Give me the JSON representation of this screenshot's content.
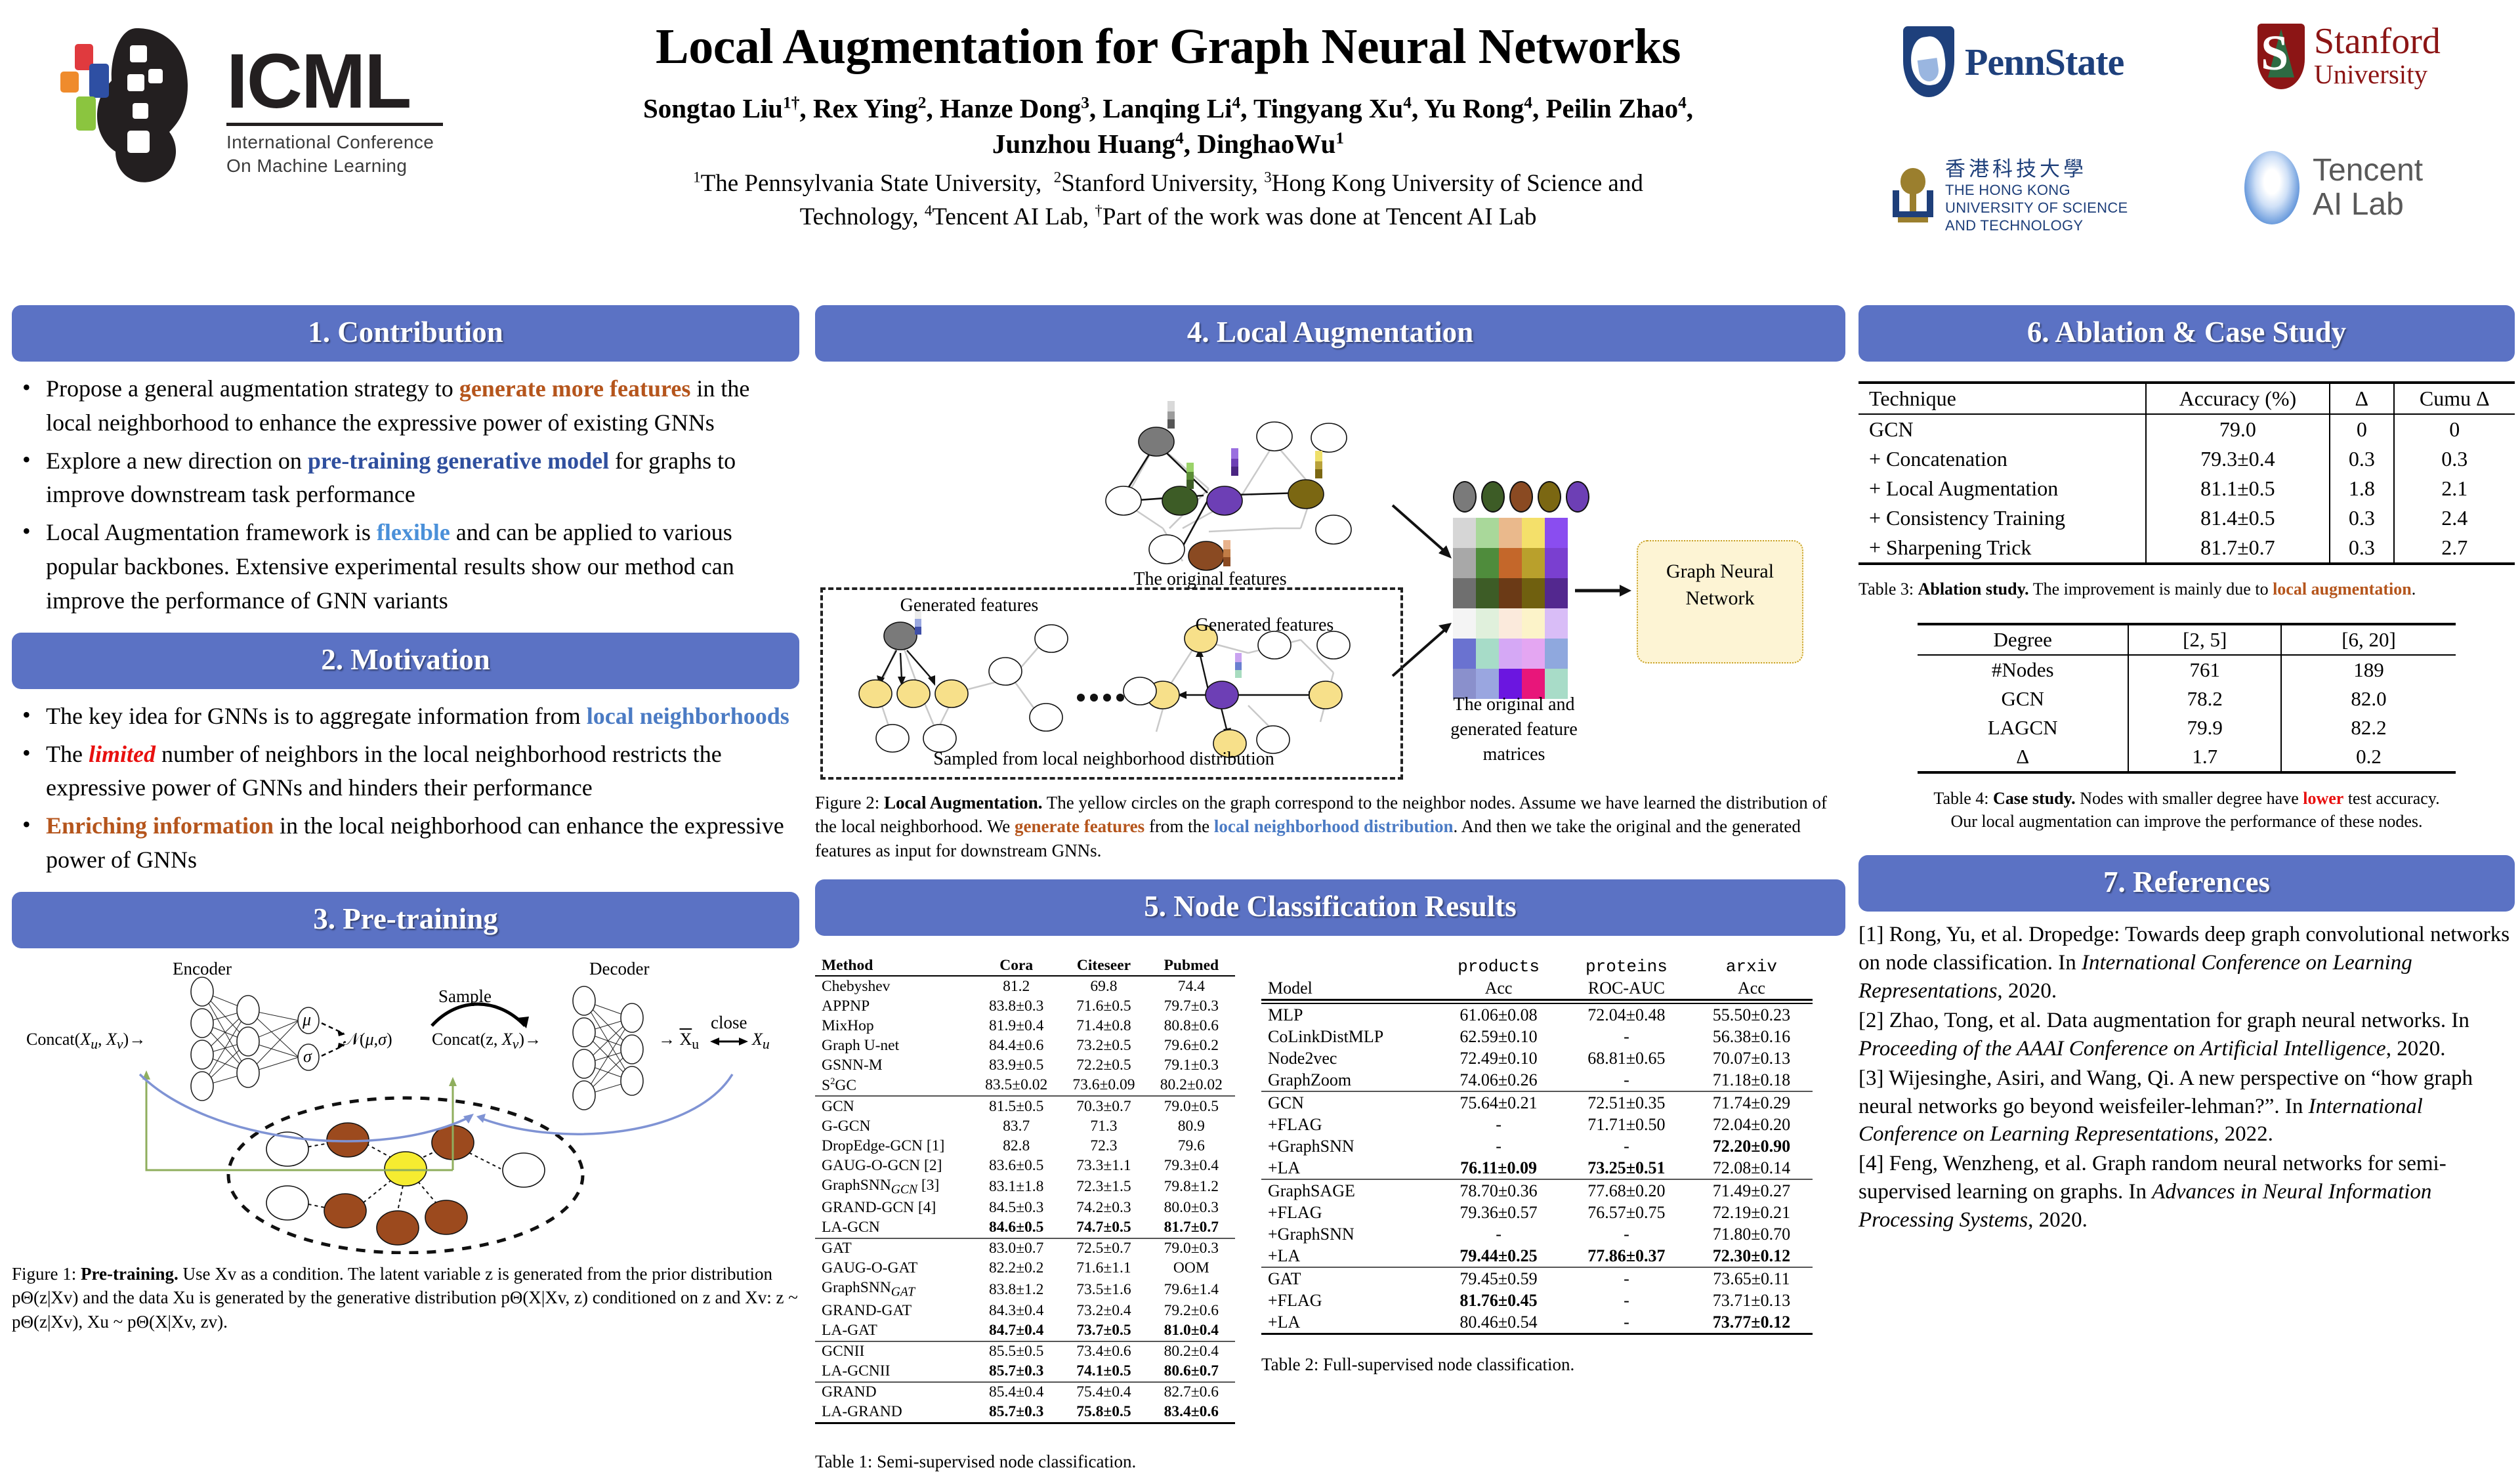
{
  "header": {
    "conference_logo": {
      "letters": "ICML",
      "line1": "International Conference",
      "line2": "On Machine Learning"
    },
    "title": "Local Augmentation for Graph Neural Networks",
    "authors_line1": "Songtao Liu1†, Rex Ying2, Hanze Dong3, Lanqing Li4, Tingyang Xu4, Yu Rong4, Peilin Zhao4,",
    "authors_line2": "Junzhou Huang4, DinghaoWu1",
    "affil_line1": "1The Pennsylvania State University,  2Stanford University, 3Hong Kong University of Science and",
    "affil_line2": "Technology, 4Tencent AI Lab, †Part of the work was done at Tencent AI Lab",
    "logos": {
      "pennstate": "PennState",
      "stanford_l1": "Stanford",
      "stanford_l2": "University",
      "stanford_mark_letter": "S",
      "hkust_cn": "香港科技大學",
      "hkust_en1": "THE HONG KONG",
      "hkust_en2": "UNIVERSITY OF SCIENCE",
      "hkust_en3": "AND TECHNOLOGY",
      "tencent_l1": "Tencent",
      "tencent_l2": "AI Lab"
    }
  },
  "section1": {
    "heading": "1. Contribution",
    "bullets": [
      {
        "parts": [
          {
            "t": "Propose a general augmentation strategy to ",
            "s": ""
          },
          {
            "t": "generate more features",
            "s": "orange"
          },
          {
            "t": " in the local neighborhood to enhance the expressive power of existing GNNs",
            "s": ""
          }
        ]
      },
      {
        "parts": [
          {
            "t": "Explore a new direction on ",
            "s": ""
          },
          {
            "t": "pre-training generative model",
            "s": "navy"
          },
          {
            "t": " for graphs to improve downstream task performance",
            "s": ""
          }
        ]
      },
      {
        "parts": [
          {
            "t": "Local Augmentation framework is ",
            "s": ""
          },
          {
            "t": "flexible",
            "s": "blue"
          },
          {
            "t": " and can be applied to various popular backbones. Extensive experimental results show our method can improve the performance of GNN variants",
            "s": ""
          }
        ]
      }
    ]
  },
  "section2": {
    "heading": "2. Motivation",
    "bullets": [
      {
        "parts": [
          {
            "t": "The key idea for GNNs is to aggregate information from ",
            "s": ""
          },
          {
            "t": "local neighborhoods",
            "s": "midblue"
          }
        ]
      },
      {
        "parts": [
          {
            "t": "The ",
            "s": ""
          },
          {
            "t": "limited",
            "s": "red-i"
          },
          {
            "t": " number of neighbors in the local neighborhood restricts the expressive power of GNNs and hinders their performance",
            "s": ""
          }
        ]
      },
      {
        "parts": [
          {
            "t": "Enriching information",
            "s": "orange"
          },
          {
            "t": " in the local neighborhood can enhance the expressive power of GNNs",
            "s": ""
          }
        ]
      }
    ]
  },
  "section3": {
    "heading": "3. Pre-training",
    "figure": {
      "encoder_label": "Encoder",
      "decoder_label": "Decoder",
      "sample_label": "Sample",
      "close_label": "close",
      "input_label": "Concat(Xu, Xv)→",
      "mu_label": "μ",
      "sigma_label": "σ",
      "dist_label": "𝒩(μ,σ)",
      "latent_label": "Concat(z, Xv)→",
      "out_label": "→ X̄u",
      "target_label": "Xu"
    },
    "caption_prefix": "Figure 1: ",
    "caption_bold": "Pre-training.",
    "caption_rest": " Use Xv as a condition. The latent variable z is generated from the prior distribution pΘ(z|Xv) and the data Xu is generated by the generative distribution pΘ(X|Xv, z) conditioned on z and Xv: z ~ pΘ(z|Xv), Xu ~ pΘ(X|Xv, zv)."
  },
  "section4": {
    "heading": "4. Local Augmentation",
    "figure": {
      "original_features": "The original features",
      "generated_features_left": "Generated features",
      "generated_features_right": "Generated features",
      "sampled_caption": "Sampled from local neighborhood distribution",
      "matrices_l1": "The original and",
      "matrices_l2": "generated feature",
      "matrices_l3": "matrices",
      "gnn_l1": "Graph Neural",
      "gnn_l2": "Network",
      "ellipsis": "······"
    },
    "caption_prefix": "Figure 2: ",
    "caption_bold": "Local Augmentation.",
    "caption_p1": " The yellow circles on the graph correspond to the neighbor nodes. Assume we have learned the distribution of the local neighborhood. We ",
    "caption_hl1": "generate features",
    "caption_p2": " from the ",
    "caption_hl2": "local neighborhood distribution",
    "caption_p3": ". And then we take the original and the generated features as input for downstream GNNs."
  },
  "section5": {
    "heading": "5. Node Classification Results",
    "table1": {
      "caption": "Table 1: Semi-supervised node classification.",
      "columns": [
        "Method",
        "Cora",
        "Citeseer",
        "Pubmed"
      ],
      "groups": [
        {
          "rows": [
            {
              "method": "Chebyshev",
              "cells": [
                "81.2",
                "69.8",
                "74.4"
              ],
              "bold": false
            },
            {
              "method": "APPNP",
              "cells": [
                "83.8±0.3",
                "71.6±0.5",
                "79.7±0.3"
              ],
              "bold": false
            },
            {
              "method": "MixHop",
              "cells": [
                "81.9±0.4",
                "71.4±0.8",
                "80.8±0.6"
              ],
              "bold": false
            },
            {
              "method": "Graph U-net",
              "cells": [
                "84.4±0.6",
                "73.2±0.5",
                "79.6±0.2"
              ],
              "bold": false
            },
            {
              "method": "GSNN-M",
              "cells": [
                "83.9±0.5",
                "72.2±0.5",
                "79.1±0.3"
              ],
              "bold": false
            },
            {
              "method": "S²GC",
              "cells": [
                "83.5±0.02",
                "73.6±0.09",
                "80.2±0.02"
              ],
              "bold": false
            }
          ]
        },
        {
          "rows": [
            {
              "method": "GCN",
              "cells": [
                "81.5±0.5",
                "70.3±0.7",
                "79.0±0.5"
              ],
              "bold": false
            },
            {
              "method": "G-GCN",
              "cells": [
                "83.7",
                "71.3",
                "80.9"
              ],
              "bold": false
            },
            {
              "method": "DropEdge-GCN [1]",
              "cells": [
                "82.8",
                "72.3",
                "79.6"
              ],
              "bold": false
            },
            {
              "method": "GAUG-O-GCN [2]",
              "cells": [
                "83.6±0.5",
                "73.3±1.1",
                "79.3±0.4"
              ],
              "bold": false
            },
            {
              "method": "GraphSNNGCN [3]",
              "cells": [
                "83.1±1.8",
                "72.3±1.5",
                "79.8±1.2"
              ],
              "bold": false
            },
            {
              "method": "GRAND-GCN [4]",
              "cells": [
                "84.5±0.3",
                "74.2±0.3",
                "80.0±0.3"
              ],
              "bold": false
            },
            {
              "method": "LA-GCN",
              "cells": [
                "84.6±0.5",
                "74.7±0.5",
                "81.7±0.7"
              ],
              "bold": true
            }
          ]
        },
        {
          "rows": [
            {
              "method": "GAT",
              "cells": [
                "83.0±0.7",
                "72.5±0.7",
                "79.0±0.3"
              ],
              "bold": false
            },
            {
              "method": "GAUG-O-GAT",
              "cells": [
                "82.2±0.2",
                "71.6±1.1",
                "OOM"
              ],
              "bold": false
            },
            {
              "method": "GraphSNNGAT",
              "cells": [
                "83.8±1.2",
                "73.5±1.6",
                "79.6±1.4"
              ],
              "bold": false
            },
            {
              "method": "GRAND-GAT",
              "cells": [
                "84.3±0.4",
                "73.2±0.4",
                "79.2±0.6"
              ],
              "bold": false
            },
            {
              "method": "LA-GAT",
              "cells": [
                "84.7±0.4",
                "73.7±0.5",
                "81.0±0.4"
              ],
              "bold": true
            }
          ]
        },
        {
          "rows": [
            {
              "method": "GCNII",
              "cells": [
                "85.5±0.5",
                "73.4±0.6",
                "80.2±0.4"
              ],
              "bold": false
            },
            {
              "method": "LA-GCNII",
              "cells": [
                "85.7±0.3",
                "74.1±0.5",
                "80.6±0.7"
              ],
              "bold": true
            }
          ]
        },
        {
          "rows": [
            {
              "method": "GRAND",
              "cells": [
                "85.4±0.4",
                "75.4±0.4",
                "82.7±0.6"
              ],
              "bold": false
            },
            {
              "method": "LA-GRAND",
              "cells": [
                "85.7±0.3",
                "75.8±0.5",
                "83.4±0.6"
              ],
              "bold": true
            }
          ]
        }
      ]
    },
    "table2": {
      "caption": "Table 2: Full-supervised node classification.",
      "header_top": [
        "",
        "products",
        "proteins",
        "arxiv"
      ],
      "header_bottom": [
        "Model",
        "Acc",
        "ROC-AUC",
        "Acc"
      ],
      "groups": [
        {
          "rows": [
            {
              "model": "MLP",
              "cells": [
                "61.06±0.08",
                "72.04±0.48",
                "55.50±0.23"
              ],
              "bold": [
                false,
                false,
                false
              ]
            },
            {
              "model": "CoLinkDistMLP",
              "cells": [
                "62.59±0.10",
                "-",
                "56.38±0.16"
              ],
              "bold": [
                false,
                false,
                false
              ]
            },
            {
              "model": "Node2vec",
              "cells": [
                "72.49±0.10",
                "68.81±0.65",
                "70.07±0.13"
              ],
              "bold": [
                false,
                false,
                false
              ]
            },
            {
              "model": "GraphZoom",
              "cells": [
                "74.06±0.26",
                "-",
                "71.18±0.18"
              ],
              "bold": [
                false,
                false,
                false
              ]
            }
          ]
        },
        {
          "rows": [
            {
              "model": "GCN",
              "cells": [
                "75.64±0.21",
                "72.51±0.35",
                "71.74±0.29"
              ],
              "bold": [
                false,
                false,
                false
              ]
            },
            {
              "model": "+FLAG",
              "cells": [
                "-",
                "71.71±0.50",
                "72.04±0.20"
              ],
              "bold": [
                false,
                false,
                false
              ]
            },
            {
              "model": "+GraphSNN",
              "cells": [
                "-",
                "-",
                "72.20±0.90"
              ],
              "bold": [
                false,
                false,
                true
              ]
            },
            {
              "model": "+LA",
              "cells": [
                "76.11±0.09",
                "73.25±0.51",
                "72.08±0.14"
              ],
              "bold": [
                true,
                true,
                false
              ]
            }
          ]
        },
        {
          "rows": [
            {
              "model": "GraphSAGE",
              "cells": [
                "78.70±0.36",
                "77.68±0.20",
                "71.49±0.27"
              ],
              "bold": [
                false,
                false,
                false
              ]
            },
            {
              "model": "+FLAG",
              "cells": [
                "79.36±0.57",
                "76.57±0.75",
                "72.19±0.21"
              ],
              "bold": [
                false,
                false,
                false
              ]
            },
            {
              "model": "+GraphSNN",
              "cells": [
                "-",
                "-",
                "71.80±0.70"
              ],
              "bold": [
                false,
                false,
                false
              ]
            },
            {
              "model": "+LA",
              "cells": [
                "79.44±0.25",
                "77.86±0.37",
                "72.30±0.12"
              ],
              "bold": [
                true,
                true,
                true
              ]
            }
          ]
        },
        {
          "rows": [
            {
              "model": "GAT",
              "cells": [
                "79.45±0.59",
                "-",
                "73.65±0.11"
              ],
              "bold": [
                false,
                false,
                false
              ]
            },
            {
              "model": "+FLAG",
              "cells": [
                "81.76±0.45",
                "-",
                "73.71±0.13"
              ],
              "bold": [
                true,
                false,
                false
              ]
            },
            {
              "model": "+LA",
              "cells": [
                "80.46±0.54",
                "-",
                "73.77±0.12"
              ],
              "bold": [
                false,
                false,
                true
              ]
            }
          ]
        }
      ]
    }
  },
  "section6": {
    "heading": "6. Ablation & Case Study",
    "table3": {
      "columns": [
        "Technique",
        "Accuracy (%)",
        "Δ",
        "Cumu Δ"
      ],
      "rows": [
        {
          "technique": "GCN",
          "accuracy": "79.0",
          "delta": "0",
          "cumu": "0"
        },
        {
          "technique": "+ Concatenation",
          "accuracy": "79.3±0.4",
          "delta": "0.3",
          "cumu": "0.3"
        },
        {
          "technique": "+ Local Augmentation",
          "accuracy": "81.1±0.5",
          "delta": "1.8",
          "cumu": "2.1"
        },
        {
          "technique": "+ Consistency Training",
          "accuracy": "81.4±0.5",
          "delta": "0.3",
          "cumu": "2.4"
        },
        {
          "technique": "+ Sharpening Trick",
          "accuracy": "81.7±0.7",
          "delta": "0.3",
          "cumu": "2.7"
        }
      ],
      "caption_prefix": "Table 3: ",
      "caption_bold": "Ablation study.",
      "caption_mid": " The improvement is mainly due to ",
      "caption_hl": "local augmentation",
      "caption_end": "."
    },
    "table4": {
      "columns": [
        "Degree",
        "[2, 5]",
        "[6, 20]"
      ],
      "rows": [
        {
          "label": "#Nodes",
          "c1": "761",
          "c2": "189"
        },
        {
          "label": "GCN",
          "c1": "78.2",
          "c2": "82.0"
        },
        {
          "label": "LAGCN",
          "c1": "79.9",
          "c2": "82.2"
        },
        {
          "label": "Δ",
          "c1": "1.7",
          "c2": "0.2"
        }
      ],
      "caption_prefix": "Table 4: ",
      "caption_bold": "Case study.",
      "caption_mid": " Nodes with smaller degree have ",
      "caption_hl": "lower",
      "caption_end": " test accuracy.",
      "caption_line2": "Our local augmentation can improve the performance of these nodes."
    }
  },
  "section7": {
    "heading": "7. References",
    "items": [
      {
        "plain1": "[1] Rong, Yu, et al. Dropedge: Towards deep graph convolutional networks on node classification. In ",
        "italic": "International Conference on Learning Representations",
        "plain2": ", 2020."
      },
      {
        "plain1": "[2] Zhao, Tong, et al. Data augmentation for graph neural networks. In ",
        "italic": "Proceeding of the AAAI Conference on Artificial Intelligence",
        "plain2": ", 2020."
      },
      {
        "plain1": "[3] Wijesinghe, Asiri, and Wang, Qi. A new perspective on “how graph neural networks go beyond weisfeiler-lehman?”. In ",
        "italic": "International Conference on Learning Representations",
        "plain2": ", 2022."
      },
      {
        "plain1": "[4] Feng, Wenzheng, et al. Graph random neural networks for semi-supervised learning on graphs. In ",
        "italic": "Advances in Neural Information Processing Systems",
        "plain2": ", 2020."
      }
    ]
  },
  "colors": {
    "band": "#5b72c4",
    "orange": "#b5551c",
    "navy": "#2f4f9e",
    "blue": "#4a90d9",
    "red": "#e8100f",
    "pennstate": "#1e407c",
    "stanford": "#8c1515",
    "hkust_blue": "#1e3f7a",
    "hkust_gold": "#9b7f2e"
  }
}
